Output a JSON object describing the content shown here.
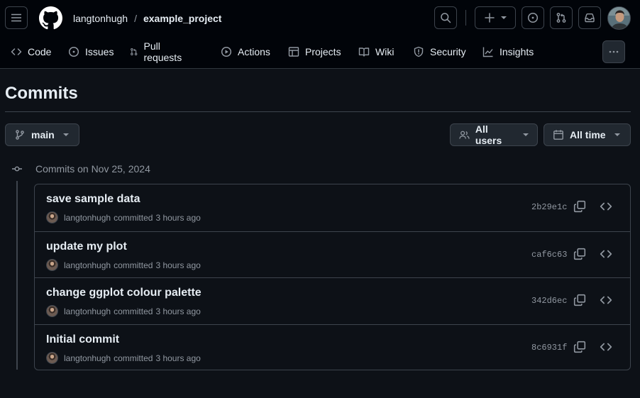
{
  "header": {
    "owner": "langtonhugh",
    "separator": "/",
    "repo": "example_project"
  },
  "nav": {
    "tabs": [
      {
        "label": "Code",
        "icon": "code-icon"
      },
      {
        "label": "Issues",
        "icon": "issue-opened-icon"
      },
      {
        "label": "Pull requests",
        "icon": "git-pull-request-icon"
      },
      {
        "label": "Actions",
        "icon": "play-icon"
      },
      {
        "label": "Projects",
        "icon": "table-icon"
      },
      {
        "label": "Wiki",
        "icon": "book-icon"
      },
      {
        "label": "Security",
        "icon": "shield-icon"
      },
      {
        "label": "Insights",
        "icon": "graph-icon"
      }
    ]
  },
  "page": {
    "title": "Commits"
  },
  "filters": {
    "branch": "main",
    "users": "All users",
    "time": "All time"
  },
  "group": {
    "heading": "Commits on Nov 25, 2024"
  },
  "commits": [
    {
      "message": "save sample data",
      "author": "langtonhugh",
      "verb": "committed",
      "time": "3 hours ago",
      "sha": "2b29e1c"
    },
    {
      "message": "update my plot",
      "author": "langtonhugh",
      "verb": "committed",
      "time": "3 hours ago",
      "sha": "caf6c63"
    },
    {
      "message": "change ggplot colour palette",
      "author": "langtonhugh",
      "verb": "committed",
      "time": "3 hours ago",
      "sha": "342d6ec"
    },
    {
      "message": "Initial commit",
      "author": "langtonhugh",
      "verb": "committed",
      "time": "3 hours ago",
      "sha": "8c6931f"
    }
  ],
  "colors": {
    "background": "#0d1117",
    "header_bg": "#010409",
    "border": "#3d444d",
    "text": "#e6edf3",
    "muted": "#9198a1"
  }
}
